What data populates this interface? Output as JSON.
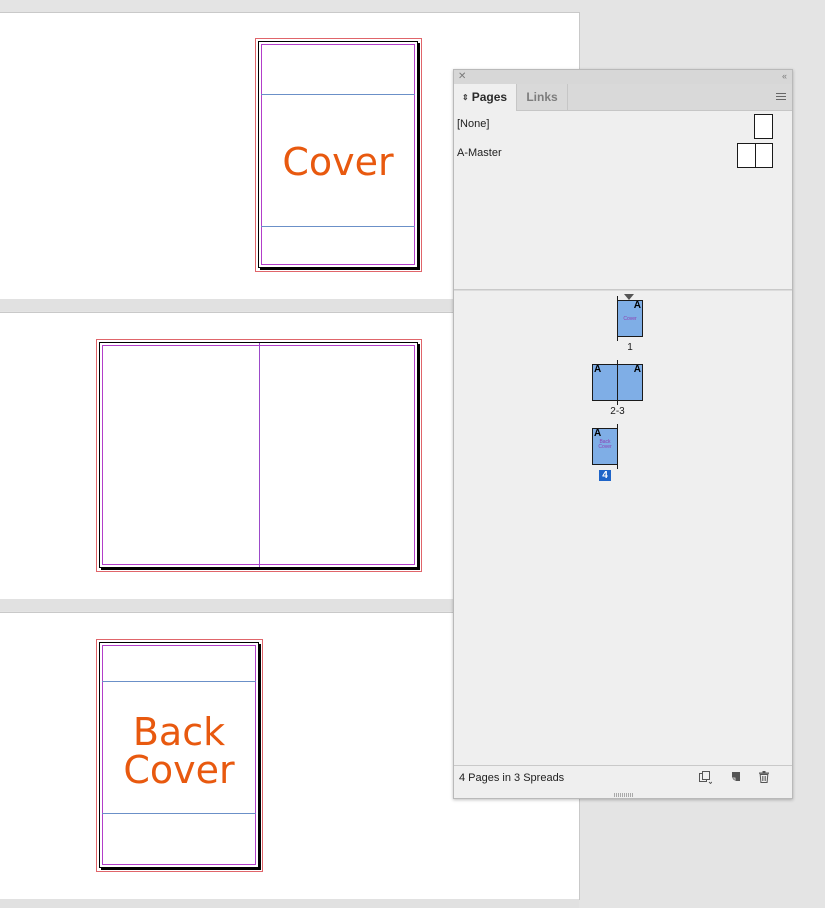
{
  "document": {
    "spreads": [
      {
        "pages": [
          {
            "text_lines": [
              "Cover"
            ]
          }
        ]
      },
      {
        "pages": [
          {
            "text_lines": []
          },
          {
            "text_lines": []
          }
        ]
      },
      {
        "pages": [
          {
            "text_lines": [
              "Back",
              "Cover"
            ]
          }
        ]
      }
    ]
  },
  "panel": {
    "tabs": [
      {
        "label": "Pages",
        "active": true
      },
      {
        "label": "Links",
        "active": false
      }
    ],
    "masters": [
      {
        "label": "[None]",
        "thumb": "single"
      },
      {
        "label": "A-Master",
        "thumb": "spread"
      }
    ],
    "page_thumbs": [
      {
        "number_label": "1",
        "master_prefixes": [
          "A"
        ],
        "thumb_text": "Cover",
        "selected": false,
        "current": true
      },
      {
        "number_label": "2-3",
        "master_prefixes": [
          "A",
          "A"
        ],
        "thumb_text": "",
        "selected": false,
        "current": false
      },
      {
        "number_label": "4",
        "master_prefixes": [
          "A"
        ],
        "thumb_text": "Back Cover",
        "selected": true,
        "current": false
      }
    ],
    "footer": {
      "status": "4 Pages in 3 Spreads",
      "icons": [
        "edit-page-size-icon",
        "new-page-icon",
        "trash-icon"
      ]
    }
  },
  "colors": {
    "page_text": "#e8590f",
    "bleed": "#e0656a",
    "margin": "#b23ec9",
    "guide": "#6b90c8",
    "thumb_fill": "#7faee6",
    "selection": "#1e64c8"
  }
}
